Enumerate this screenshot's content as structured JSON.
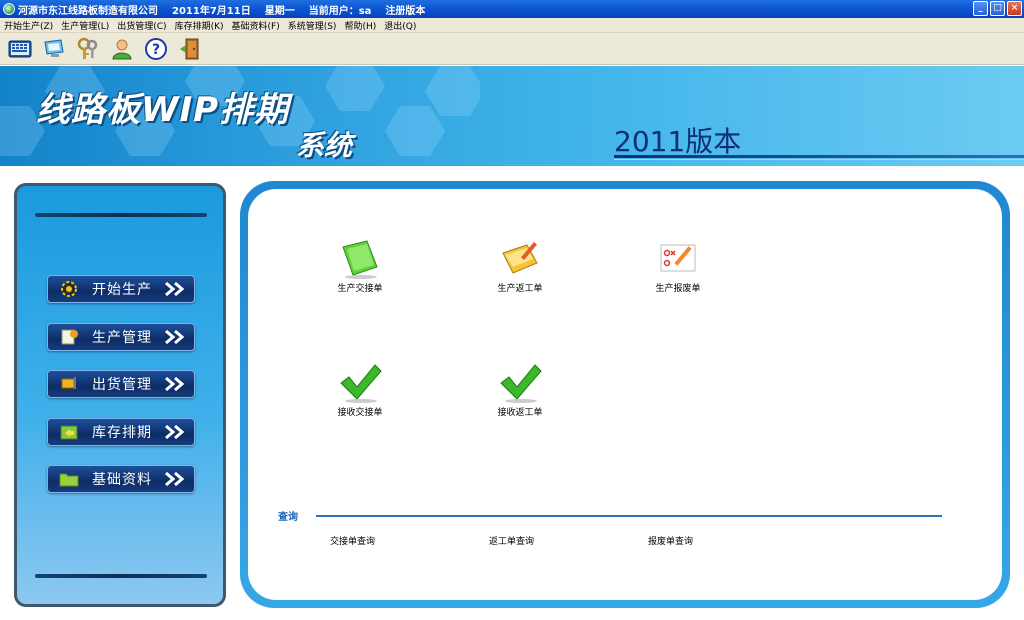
{
  "titlebar": {
    "company": "河源市东江线路板制造有限公司",
    "date": "2011年7月11日",
    "weekday": "星期一",
    "current_user": "当前用户：sa",
    "edition": "注册版本",
    "min_label": "_",
    "max_label": "□",
    "close_label": "×"
  },
  "menu": [
    "开始生产(Z)",
    "生产管理(L)",
    "出货管理(C)",
    "库存排期(K)",
    "基础资料(F)",
    "系统管理(S)",
    "帮助(H)",
    "退出(Q)"
  ],
  "toolbar": [
    "calculator-icon",
    "monitor-icon",
    "keys-icon",
    "user-icon",
    "help-icon",
    "exit-door-icon"
  ],
  "banner": {
    "title_line1": "线路板WIP排期",
    "title_line2": "系统",
    "version": "2011版本"
  },
  "nav": [
    {
      "label": "开始生产",
      "icon": "gear-icon"
    },
    {
      "label": "生产管理",
      "icon": "document-gear-icon"
    },
    {
      "label": "出货管理",
      "icon": "forklift-icon"
    },
    {
      "label": "库存排期",
      "icon": "folder-arrow-icon"
    },
    {
      "label": "基础资料",
      "icon": "folder-icon"
    }
  ],
  "modules": {
    "row1": [
      "生产交接单",
      "生产返工单",
      "生产报废单"
    ],
    "row2": [
      "接收交接单",
      "接收返工单"
    ]
  },
  "query": {
    "title": "查询",
    "links": [
      "交接单查询",
      "返工单查询",
      "报废单查询"
    ]
  },
  "colors": {
    "titlebar": "#0a4fd0",
    "banner": "#2ea0de",
    "panel_border": "#1f88d0",
    "nav_button": "#0d2d66",
    "query_accent": "#1a66b8"
  }
}
